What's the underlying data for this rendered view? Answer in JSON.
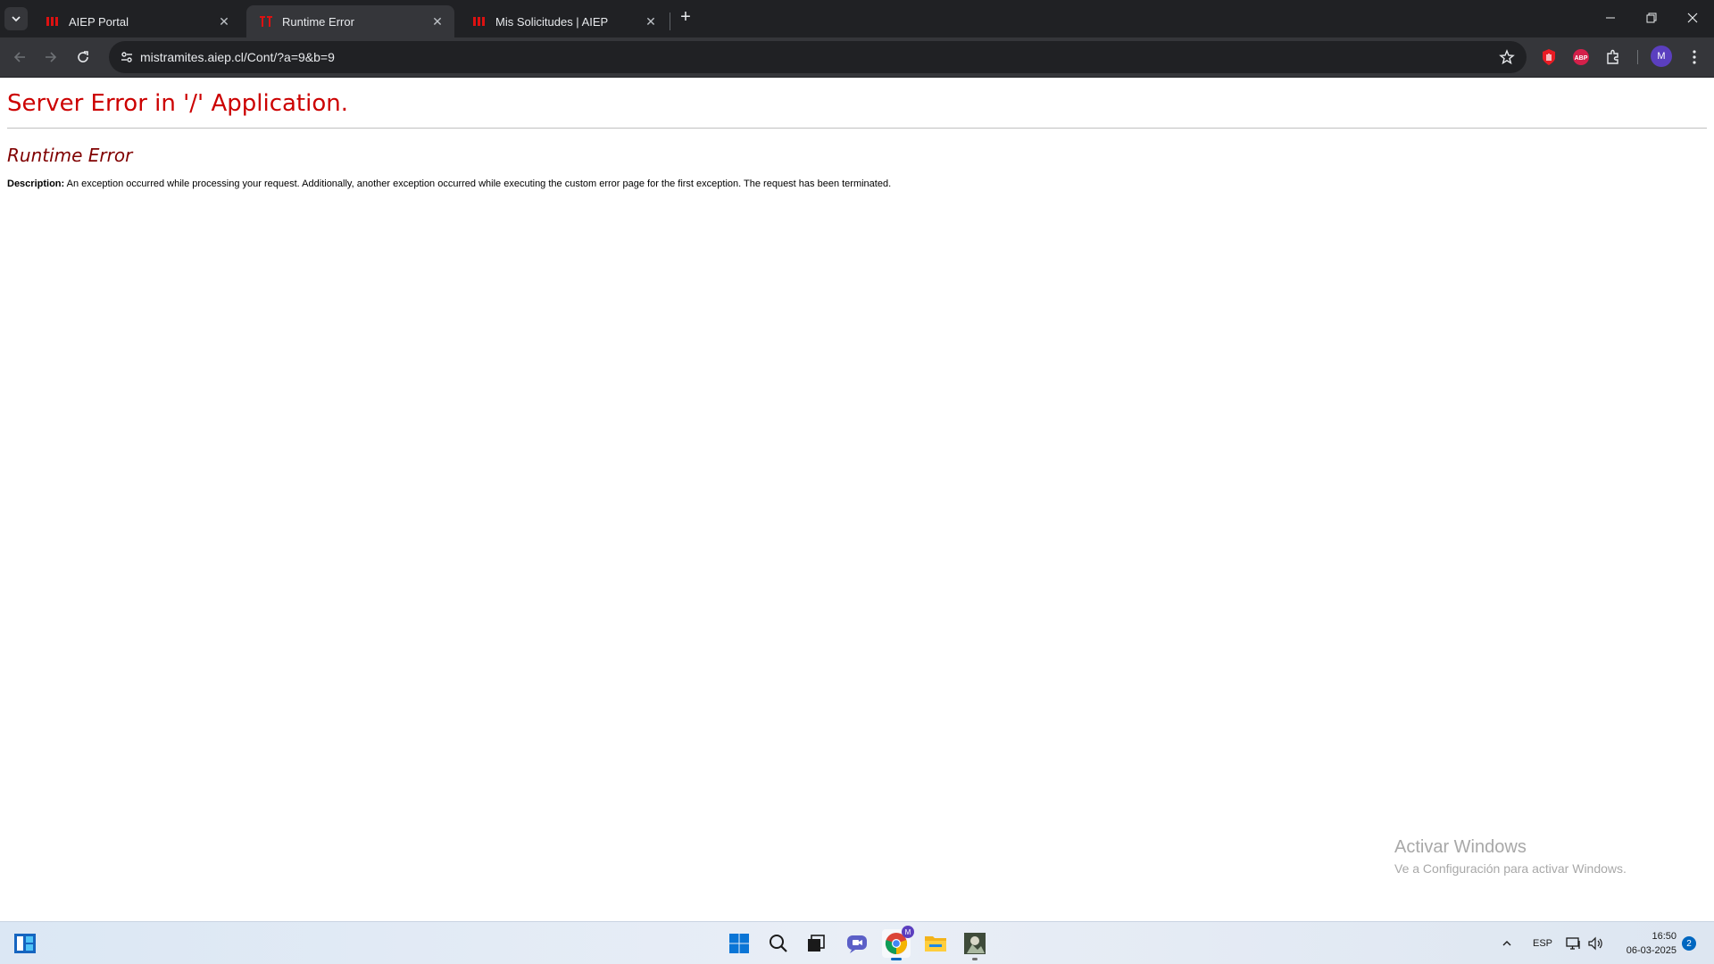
{
  "browser": {
    "tabs": [
      {
        "title": "AIEP Portal",
        "active": false
      },
      {
        "title": "Runtime Error",
        "active": true
      },
      {
        "title": "Mis Solicitudes | AIEP",
        "active": false
      }
    ],
    "url": "mistramites.aiep.cl/Cont/?a=9&b=9",
    "profile_initial": "M",
    "extensions": [
      "adblock-red-hand-icon",
      "abp-icon",
      "extensions-puzzle-icon"
    ]
  },
  "page": {
    "heading": "Server Error in '/' Application.",
    "subheading": "Runtime Error",
    "description_label": "Description:",
    "description_text": "An exception occurred while processing your request. Additionally, another exception occurred while executing the custom error page for the first exception. The request has been terminated."
  },
  "watermark": {
    "title": "Activar Windows",
    "subtitle": "Ve a Configuración para activar Windows."
  },
  "taskbar": {
    "language": "ESP",
    "time": "16:50",
    "date": "06-03-2025",
    "notification_count": "2",
    "chrome_badge": "M"
  },
  "colors": {
    "heading": "#cc0000",
    "subheading": "#800000",
    "accent": "#0067c0"
  }
}
